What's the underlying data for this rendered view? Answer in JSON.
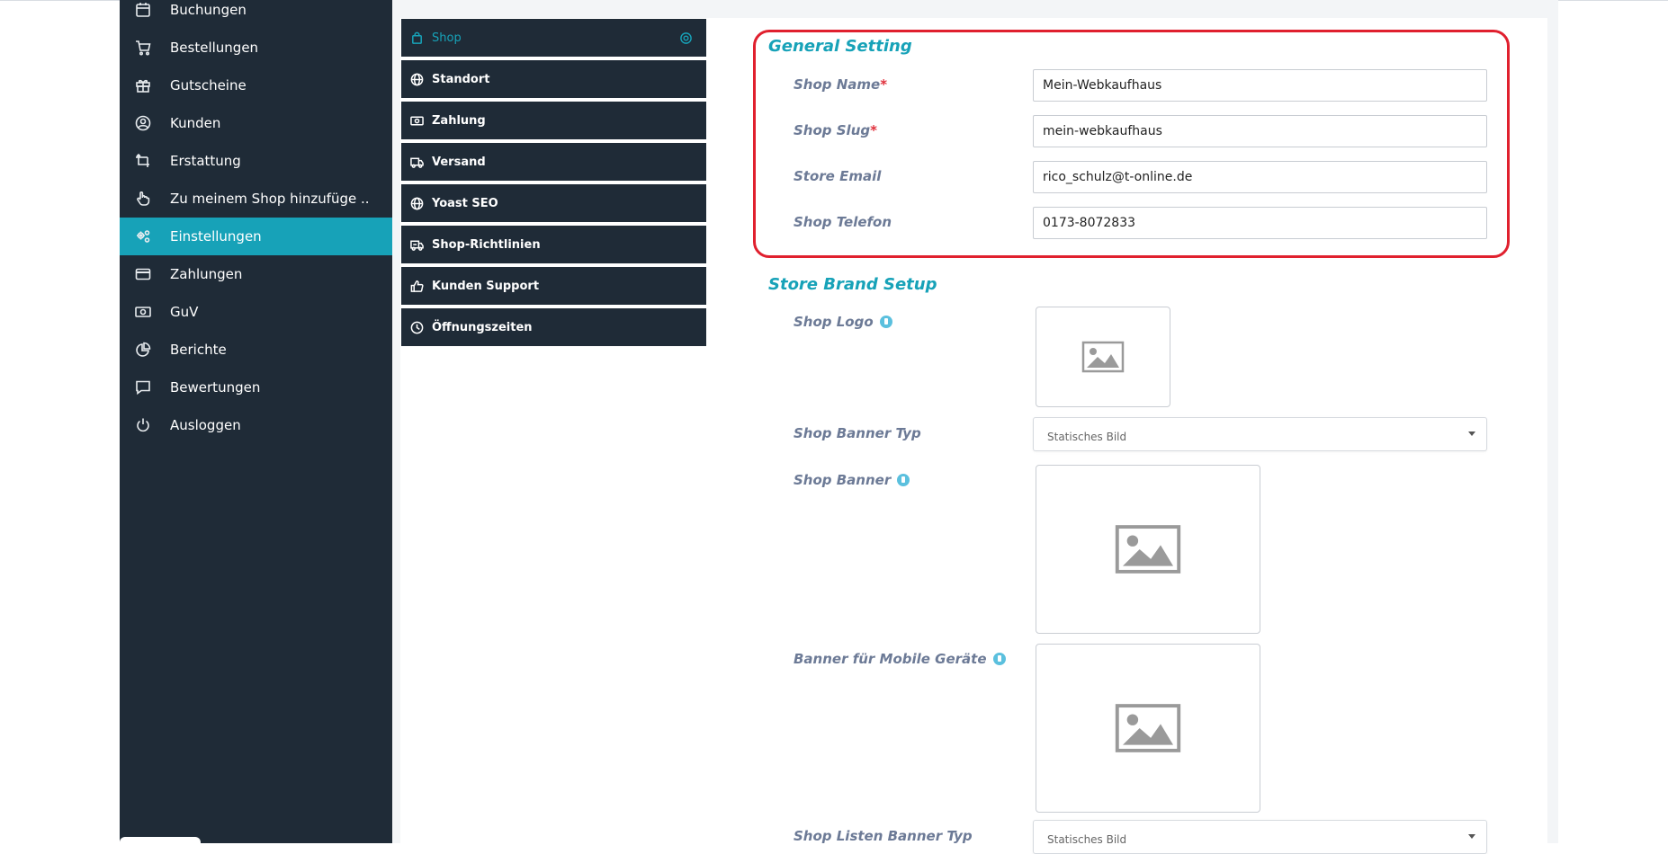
{
  "sidebar": {
    "items": [
      {
        "label": "Buchungen",
        "icon": "calendar-icon"
      },
      {
        "label": "Bestellungen",
        "icon": "cart-icon"
      },
      {
        "label": "Gutscheine",
        "icon": "gift-icon"
      },
      {
        "label": "Kunden",
        "icon": "user-circle-icon"
      },
      {
        "label": "Erstattung",
        "icon": "refund-arrows-icon"
      },
      {
        "label": "Zu meinem Shop hinzufüge ..",
        "icon": "hand-pointer-icon"
      },
      {
        "label": "Einstellungen",
        "icon": "gears-icon",
        "active": true
      },
      {
        "label": "Zahlungen",
        "icon": "credit-card-icon"
      },
      {
        "label": "GuV",
        "icon": "money-bill-icon"
      },
      {
        "label": "Berichte",
        "icon": "pie-chart-icon"
      },
      {
        "label": "Bewertungen",
        "icon": "comment-icon"
      },
      {
        "label": "Ausloggen",
        "icon": "power-icon"
      }
    ],
    "active_color": "#17a2b8",
    "bg_color": "#1f2b37"
  },
  "submenu": {
    "items": [
      {
        "label": "Shop",
        "icon": "shopping-bag-icon",
        "active": true
      },
      {
        "label": "Standort",
        "icon": "globe-icon"
      },
      {
        "label": "Zahlung",
        "icon": "money-bill-icon"
      },
      {
        "label": "Versand",
        "icon": "truck-icon"
      },
      {
        "label": "Yoast SEO",
        "icon": "globe-icon"
      },
      {
        "label": "Shop-Richtlinien",
        "icon": "truck-policy-icon"
      },
      {
        "label": "Kunden Support",
        "icon": "thumbs-up-icon"
      },
      {
        "label": "Öffnungszeiten",
        "icon": "clock-icon"
      }
    ]
  },
  "general": {
    "title": "General Setting",
    "fields": [
      {
        "label": "Shop Name",
        "required": "*",
        "value": "Mein-Webkaufhaus"
      },
      {
        "label": "Shop Slug",
        "required": "*",
        "value": "mein-webkaufhaus"
      },
      {
        "label": "Store Email",
        "required": "",
        "value": "rico_schulz@t-online.de"
      },
      {
        "label": "Shop Telefon",
        "required": "",
        "value": "0173-8072833"
      }
    ]
  },
  "brand": {
    "title": "Store Brand Setup",
    "logo_label": "Shop Logo",
    "banner_type_label": "Shop Banner Typ",
    "banner_type_value": "Statisches Bild",
    "banner_label": "Shop Banner",
    "mobile_banner_label": "Banner für Mobile Geräte",
    "list_banner_type_label": "Shop Listen Banner Typ",
    "list_banner_type_value": "Statisches Bild"
  },
  "colors": {
    "accent": "#17a2b8",
    "highlight_box": "#e0202e",
    "required": "#e0303b"
  }
}
